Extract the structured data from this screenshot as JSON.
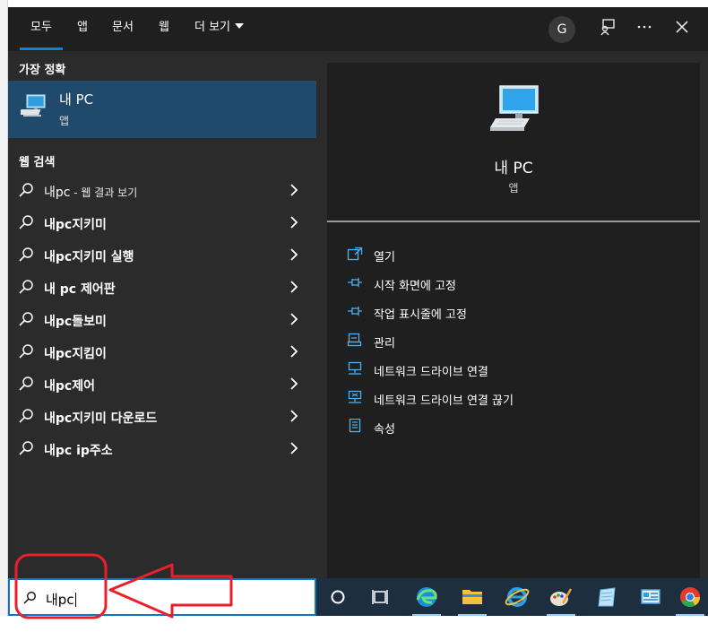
{
  "tabs": [
    {
      "label": "모두"
    },
    {
      "label": "앱"
    },
    {
      "label": "문서"
    },
    {
      "label": "웹"
    },
    {
      "label": "더 보기"
    }
  ],
  "header": {
    "avatar_letter": "G",
    "feedback_icon": "feedback-icon",
    "more_icon": "ellipsis-icon",
    "close_icon": "close-icon"
  },
  "left": {
    "best_match_heading": "가장 정확",
    "best_match": {
      "title": "내 PC",
      "subtitle": "앱"
    },
    "web_heading": "웹 검색",
    "web_items": [
      {
        "bold": "내pc",
        "rest": " - 웹 결과 보기"
      },
      {
        "bold": "내pc지키미",
        "rest": ""
      },
      {
        "bold": "내pc지키미 실행",
        "rest": ""
      },
      {
        "bold": "내 pc 제어판",
        "rest": ""
      },
      {
        "bold": "내pc돌보미",
        "rest": ""
      },
      {
        "bold": "내pc지킴이",
        "rest": ""
      },
      {
        "bold": "내pc제어",
        "rest": ""
      },
      {
        "bold": "내pc지키미 다운로드",
        "rest": ""
      },
      {
        "bold": "내pc ip주소",
        "rest": ""
      }
    ]
  },
  "right": {
    "title": "내 PC",
    "subtitle": "앱",
    "actions": [
      {
        "label": "열기",
        "icon": "open-icon"
      },
      {
        "label": "시작 화면에 고정",
        "icon": "pin-icon"
      },
      {
        "label": "작업 표시줄에 고정",
        "icon": "pin-icon"
      },
      {
        "label": "관리",
        "icon": "manage-icon"
      },
      {
        "label": "네트워크 드라이브 연결",
        "icon": "network-drive-icon"
      },
      {
        "label": "네트워크 드라이브 연결 끊기",
        "icon": "network-drive-disconnect-icon"
      },
      {
        "label": "속성",
        "icon": "properties-icon"
      }
    ]
  },
  "taskbar": {
    "search_value": "내pc",
    "apps": [
      "cortana-icon",
      "task-view-icon",
      "edge-icon",
      "file-explorer-icon",
      "internet-explorer-icon",
      "paint-icon",
      "notepad-icon",
      "control-panel-icon",
      "chrome-icon"
    ]
  },
  "colors": {
    "accent": "#0a84d8",
    "selected": "#1f4a6b",
    "annotation": "#e8202a"
  }
}
